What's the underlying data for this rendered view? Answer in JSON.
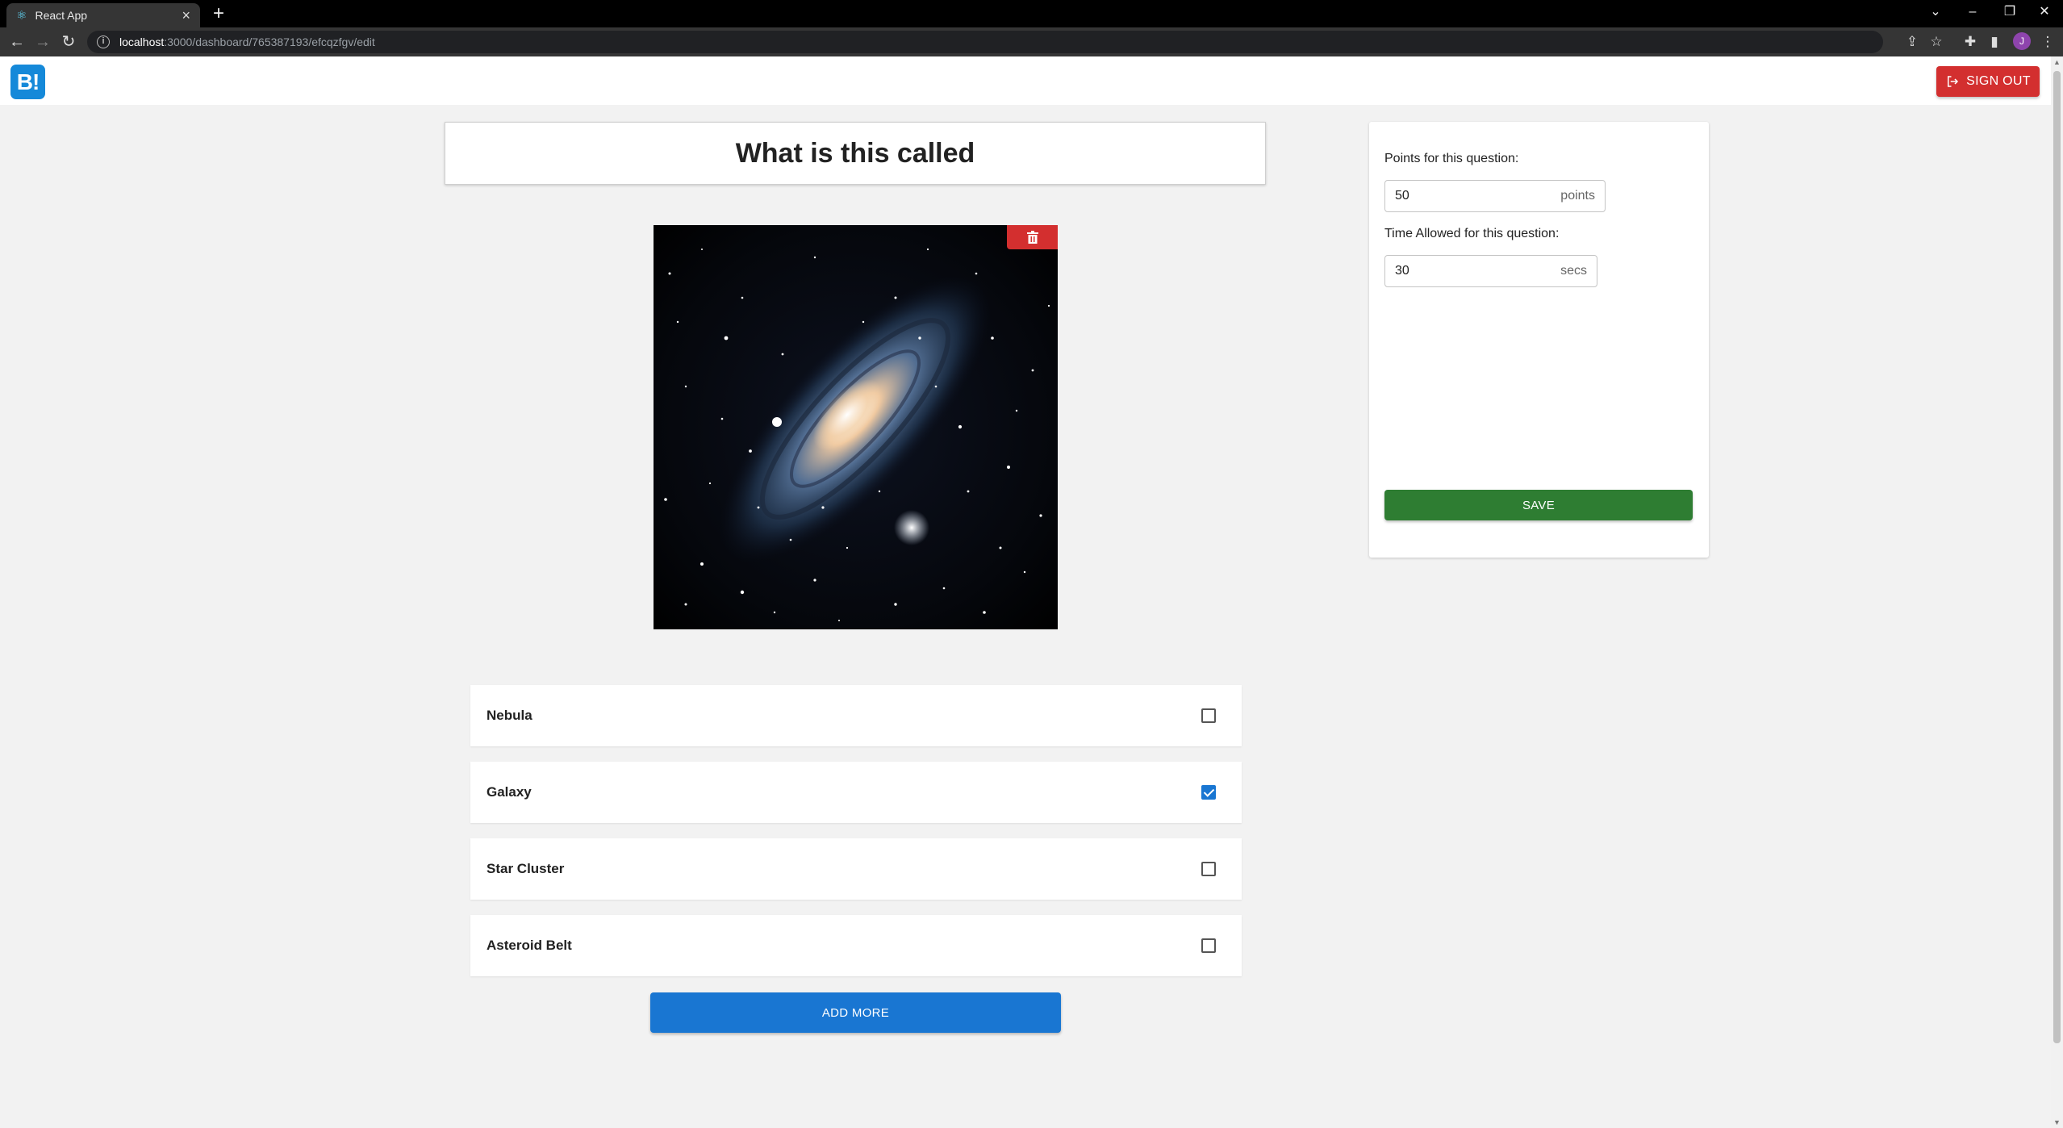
{
  "browser": {
    "tab_title": "React App",
    "url_host": "localhost",
    "url_path": ":3000/dashboard/765387193/efcqzfgv/edit",
    "profile_initial": "J"
  },
  "header": {
    "logo_text": "B!",
    "signout_label": "SIGN OUT"
  },
  "question": {
    "title": "What is this called"
  },
  "answers": [
    {
      "label": "Nebula",
      "checked": false
    },
    {
      "label": "Galaxy",
      "checked": true
    },
    {
      "label": "Star Cluster",
      "checked": false
    },
    {
      "label": "Asteroid Belt",
      "checked": false
    }
  ],
  "add_more_label": "ADD MORE",
  "settings": {
    "points_label": "Points for this question:",
    "points_value": "50",
    "points_unit": "points",
    "time_label": "Time Allowed for this question:",
    "time_value": "30",
    "time_unit": "secs",
    "save_label": "SAVE"
  },
  "colors": {
    "primary": "#1976d2",
    "danger": "#d32f2f",
    "success": "#2e7d32",
    "logo": "#1589d9"
  }
}
